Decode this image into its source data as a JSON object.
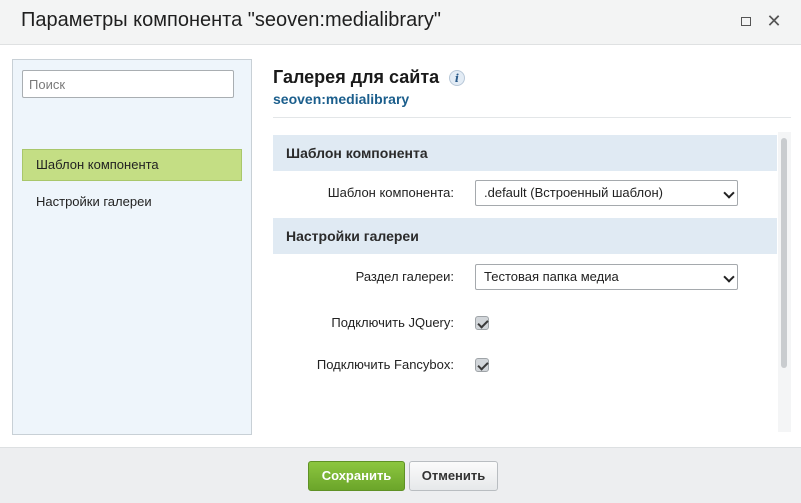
{
  "window": {
    "title": "Параметры компонента \"seoven:medialibrary\"",
    "maximize_icon": "maximize-icon",
    "close_icon": "close-icon",
    "close_glyph": "✕"
  },
  "sidebar": {
    "search_placeholder": "Поиск",
    "items": [
      {
        "label": "Шаблон компонента",
        "active": true
      },
      {
        "label": "Настройки галереи",
        "active": false
      }
    ]
  },
  "main": {
    "title": "Галерея для сайта",
    "info_glyph": "i",
    "subtitle": "seoven:medialibrary",
    "sections": [
      {
        "header": "Шаблон компонента",
        "fields": [
          {
            "label": "Шаблон компонента:",
            "type": "select",
            "value": ".default (Встроенный шаблон)"
          }
        ]
      },
      {
        "header": "Настройки галереи",
        "fields": [
          {
            "label": "Раздел галереи:",
            "type": "select",
            "value": "Тестовая папка медиа"
          },
          {
            "label": "Подключить JQuery:",
            "type": "checkbox",
            "checked": true
          },
          {
            "label": "Подключить Fancybox:",
            "type": "checkbox",
            "checked": true
          }
        ]
      }
    ]
  },
  "footer": {
    "save_label": "Сохранить",
    "cancel_label": "Отменить"
  },
  "colors": {
    "accent_green": "#8cc63f",
    "active_item": "#c4de84",
    "section_header": "#e0eaf3",
    "link_blue": "#1b5e8c"
  }
}
